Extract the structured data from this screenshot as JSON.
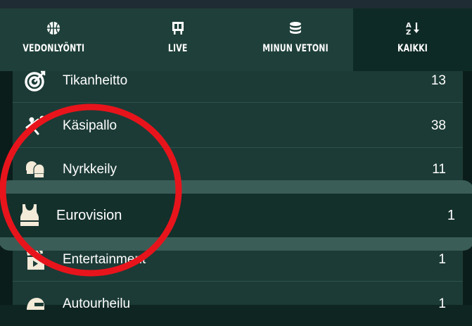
{
  "tabs": [
    {
      "label": "VEDONLYÖNTI",
      "icon": "basketball-icon"
    },
    {
      "label": "LIVE",
      "icon": "scoreboard-icon"
    },
    {
      "label": "MINUN VETONI",
      "icon": "coin-stack-icon"
    },
    {
      "label": "KAIKKI",
      "icon": "sort-az-icon",
      "active": true
    }
  ],
  "sports": [
    {
      "name": "Tikanheitto",
      "count": "13",
      "icon": "darts-target-icon"
    },
    {
      "name": "Käsipallo",
      "count": "38",
      "icon": "handball-icon"
    },
    {
      "name": "Nyrkkeily",
      "count": "11",
      "icon": "boxing-gloves-icon"
    },
    {
      "name": "Eurovision",
      "count": "1",
      "icon": "singlet-icon",
      "highlighted": true
    },
    {
      "name": "Entertainment",
      "count": "1",
      "icon": "clapperboard-icon"
    },
    {
      "name": "Autourheilu",
      "count": "1",
      "icon": "racing-helmet-icon"
    }
  ],
  "colors": {
    "accent_circle": "#e8141c",
    "tab_bar": "#1f403a",
    "list_bg": "#1c3b36"
  }
}
